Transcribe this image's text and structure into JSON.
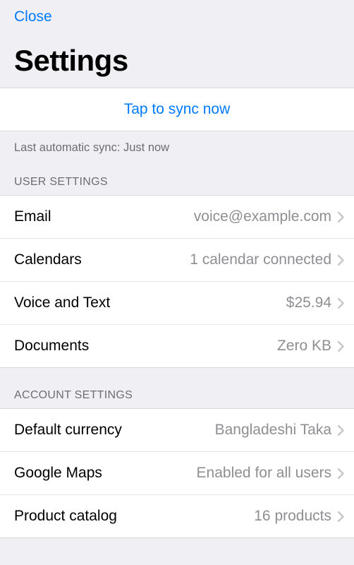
{
  "header": {
    "close_label": "Close",
    "title": "Settings"
  },
  "sync": {
    "action_label": "Tap to sync now",
    "last_sync_label": "Last automatic sync: Just now"
  },
  "sections": {
    "user_settings": {
      "header": "USER SETTINGS",
      "rows": [
        {
          "label": "Email",
          "value": "voice@example.com"
        },
        {
          "label": "Calendars",
          "value": "1 calendar connected"
        },
        {
          "label": "Voice and Text",
          "value": "$25.94"
        },
        {
          "label": "Documents",
          "value": "Zero KB"
        }
      ]
    },
    "account_settings": {
      "header": "ACCOUNT SETTINGS",
      "rows": [
        {
          "label": "Default currency",
          "value": "Bangladeshi Taka"
        },
        {
          "label": "Google Maps",
          "value": "Enabled for all users"
        },
        {
          "label": "Product catalog",
          "value": "16 products"
        }
      ]
    }
  }
}
